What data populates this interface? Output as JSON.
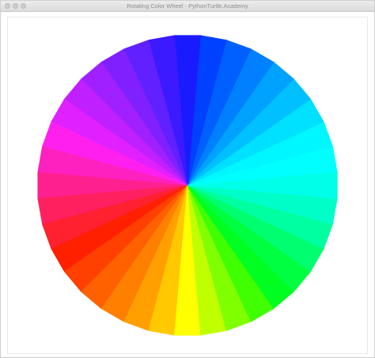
{
  "window": {
    "title": "Rotating Color Wheel - PythonTurtle.Academy",
    "buttons": [
      "close",
      "minimize",
      "zoom"
    ]
  },
  "wheel": {
    "segment_count": 36,
    "colors": [
      "#00ffff",
      "#00f7ff",
      "#00e0ff",
      "#00c0ff",
      "#00a2ff",
      "#0080ff",
      "#0060ff",
      "#0040ff",
      "#1a1aff",
      "#3b1aff",
      "#6020ff",
      "#8020ff",
      "#a020ff",
      "#c020ff",
      "#e020ff",
      "#ff20f0",
      "#ff20c0",
      "#ff2090",
      "#ff2060",
      "#ff2030",
      "#ff2000",
      "#ff4000",
      "#ff6000",
      "#ff8000",
      "#ffa000",
      "#ffc800",
      "#ffff00",
      "#c0ff00",
      "#80ff00",
      "#40ff00",
      "#00ff20",
      "#00ff40",
      "#00ff70",
      "#00ffa0",
      "#00ffc8",
      "#00ffe8"
    ]
  }
}
